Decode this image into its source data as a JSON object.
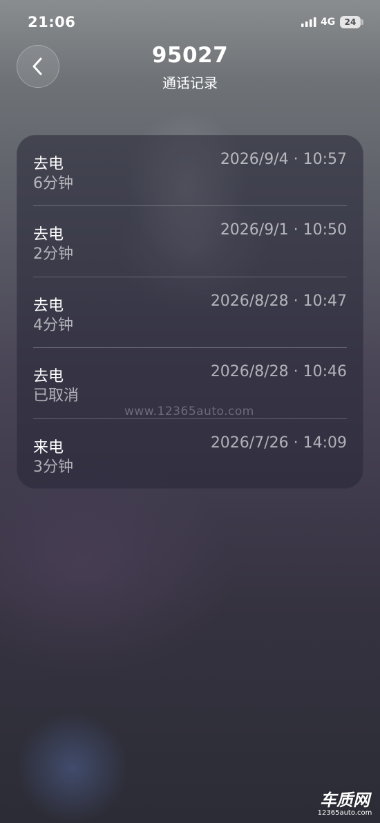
{
  "status_bar": {
    "time": "21:06",
    "network": "4G",
    "battery": "24"
  },
  "header": {
    "title": "95027",
    "subtitle": "通话记录",
    "back_icon": "chevron-left-icon"
  },
  "calls": [
    {
      "type": "去电",
      "duration": "6分钟",
      "datetime": "2026/9/4 · 10:57"
    },
    {
      "type": "去电",
      "duration": "2分钟",
      "datetime": "2026/9/1 · 10:50"
    },
    {
      "type": "去电",
      "duration": "4分钟",
      "datetime": "2026/8/28 · 10:47"
    },
    {
      "type": "去电",
      "duration": "已取消",
      "datetime": "2026/8/28 · 10:46"
    },
    {
      "type": "来电",
      "duration": "3分钟",
      "datetime": "2026/7/26 · 14:09"
    }
  ],
  "watermark": {
    "url": "www.12365auto.com",
    "logo_text": "车质网",
    "logo_sub": "12365auto.com"
  }
}
